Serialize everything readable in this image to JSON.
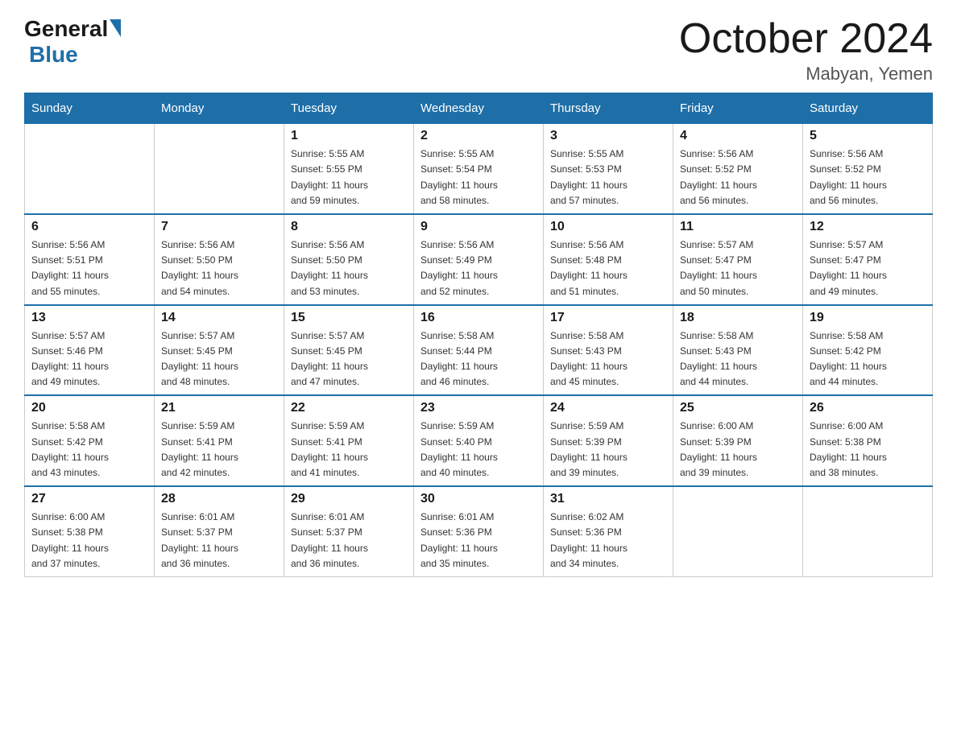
{
  "header": {
    "logo_general": "General",
    "logo_blue": "Blue",
    "month_title": "October 2024",
    "location": "Mabyan, Yemen"
  },
  "calendar": {
    "days_of_week": [
      "Sunday",
      "Monday",
      "Tuesday",
      "Wednesday",
      "Thursday",
      "Friday",
      "Saturday"
    ],
    "weeks": [
      [
        {
          "day": "",
          "info": ""
        },
        {
          "day": "",
          "info": ""
        },
        {
          "day": "1",
          "info": "Sunrise: 5:55 AM\nSunset: 5:55 PM\nDaylight: 11 hours\nand 59 minutes."
        },
        {
          "day": "2",
          "info": "Sunrise: 5:55 AM\nSunset: 5:54 PM\nDaylight: 11 hours\nand 58 minutes."
        },
        {
          "day": "3",
          "info": "Sunrise: 5:55 AM\nSunset: 5:53 PM\nDaylight: 11 hours\nand 57 minutes."
        },
        {
          "day": "4",
          "info": "Sunrise: 5:56 AM\nSunset: 5:52 PM\nDaylight: 11 hours\nand 56 minutes."
        },
        {
          "day": "5",
          "info": "Sunrise: 5:56 AM\nSunset: 5:52 PM\nDaylight: 11 hours\nand 56 minutes."
        }
      ],
      [
        {
          "day": "6",
          "info": "Sunrise: 5:56 AM\nSunset: 5:51 PM\nDaylight: 11 hours\nand 55 minutes."
        },
        {
          "day": "7",
          "info": "Sunrise: 5:56 AM\nSunset: 5:50 PM\nDaylight: 11 hours\nand 54 minutes."
        },
        {
          "day": "8",
          "info": "Sunrise: 5:56 AM\nSunset: 5:50 PM\nDaylight: 11 hours\nand 53 minutes."
        },
        {
          "day": "9",
          "info": "Sunrise: 5:56 AM\nSunset: 5:49 PM\nDaylight: 11 hours\nand 52 minutes."
        },
        {
          "day": "10",
          "info": "Sunrise: 5:56 AM\nSunset: 5:48 PM\nDaylight: 11 hours\nand 51 minutes."
        },
        {
          "day": "11",
          "info": "Sunrise: 5:57 AM\nSunset: 5:47 PM\nDaylight: 11 hours\nand 50 minutes."
        },
        {
          "day": "12",
          "info": "Sunrise: 5:57 AM\nSunset: 5:47 PM\nDaylight: 11 hours\nand 49 minutes."
        }
      ],
      [
        {
          "day": "13",
          "info": "Sunrise: 5:57 AM\nSunset: 5:46 PM\nDaylight: 11 hours\nand 49 minutes."
        },
        {
          "day": "14",
          "info": "Sunrise: 5:57 AM\nSunset: 5:45 PM\nDaylight: 11 hours\nand 48 minutes."
        },
        {
          "day": "15",
          "info": "Sunrise: 5:57 AM\nSunset: 5:45 PM\nDaylight: 11 hours\nand 47 minutes."
        },
        {
          "day": "16",
          "info": "Sunrise: 5:58 AM\nSunset: 5:44 PM\nDaylight: 11 hours\nand 46 minutes."
        },
        {
          "day": "17",
          "info": "Sunrise: 5:58 AM\nSunset: 5:43 PM\nDaylight: 11 hours\nand 45 minutes."
        },
        {
          "day": "18",
          "info": "Sunrise: 5:58 AM\nSunset: 5:43 PM\nDaylight: 11 hours\nand 44 minutes."
        },
        {
          "day": "19",
          "info": "Sunrise: 5:58 AM\nSunset: 5:42 PM\nDaylight: 11 hours\nand 44 minutes."
        }
      ],
      [
        {
          "day": "20",
          "info": "Sunrise: 5:58 AM\nSunset: 5:42 PM\nDaylight: 11 hours\nand 43 minutes."
        },
        {
          "day": "21",
          "info": "Sunrise: 5:59 AM\nSunset: 5:41 PM\nDaylight: 11 hours\nand 42 minutes."
        },
        {
          "day": "22",
          "info": "Sunrise: 5:59 AM\nSunset: 5:41 PM\nDaylight: 11 hours\nand 41 minutes."
        },
        {
          "day": "23",
          "info": "Sunrise: 5:59 AM\nSunset: 5:40 PM\nDaylight: 11 hours\nand 40 minutes."
        },
        {
          "day": "24",
          "info": "Sunrise: 5:59 AM\nSunset: 5:39 PM\nDaylight: 11 hours\nand 39 minutes."
        },
        {
          "day": "25",
          "info": "Sunrise: 6:00 AM\nSunset: 5:39 PM\nDaylight: 11 hours\nand 39 minutes."
        },
        {
          "day": "26",
          "info": "Sunrise: 6:00 AM\nSunset: 5:38 PM\nDaylight: 11 hours\nand 38 minutes."
        }
      ],
      [
        {
          "day": "27",
          "info": "Sunrise: 6:00 AM\nSunset: 5:38 PM\nDaylight: 11 hours\nand 37 minutes."
        },
        {
          "day": "28",
          "info": "Sunrise: 6:01 AM\nSunset: 5:37 PM\nDaylight: 11 hours\nand 36 minutes."
        },
        {
          "day": "29",
          "info": "Sunrise: 6:01 AM\nSunset: 5:37 PM\nDaylight: 11 hours\nand 36 minutes."
        },
        {
          "day": "30",
          "info": "Sunrise: 6:01 AM\nSunset: 5:36 PM\nDaylight: 11 hours\nand 35 minutes."
        },
        {
          "day": "31",
          "info": "Sunrise: 6:02 AM\nSunset: 5:36 PM\nDaylight: 11 hours\nand 34 minutes."
        },
        {
          "day": "",
          "info": ""
        },
        {
          "day": "",
          "info": ""
        }
      ]
    ]
  }
}
